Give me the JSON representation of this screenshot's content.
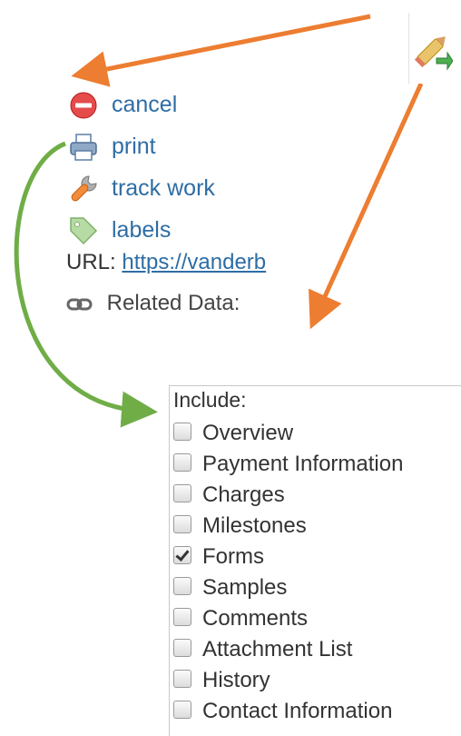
{
  "menu": {
    "items": [
      {
        "label": "cancel",
        "icon": "cancel-icon"
      },
      {
        "label": "print",
        "icon": "printer-icon"
      },
      {
        "label": "track work",
        "icon": "wrench-icon"
      },
      {
        "label": "labels",
        "icon": "tag-icon"
      }
    ]
  },
  "url": {
    "label": "URL:",
    "link": "https://vanderb"
  },
  "related": {
    "label": "Related Data:",
    "icon": "link-icon"
  },
  "include": {
    "title": "Include:",
    "options": [
      {
        "label": "Overview",
        "checked": false
      },
      {
        "label": "Payment Information",
        "checked": false
      },
      {
        "label": "Charges",
        "checked": false
      },
      {
        "label": "Milestones",
        "checked": false
      },
      {
        "label": "Forms",
        "checked": true
      },
      {
        "label": "Samples",
        "checked": false
      },
      {
        "label": "Comments",
        "checked": false
      },
      {
        "label": "Attachment List",
        "checked": false
      },
      {
        "label": "History",
        "checked": false
      },
      {
        "label": "Contact Information",
        "checked": false
      }
    ]
  },
  "colors": {
    "link": "#2e6da4",
    "arrow_orange": "#ed7d31",
    "arrow_green": "#70ad47"
  }
}
